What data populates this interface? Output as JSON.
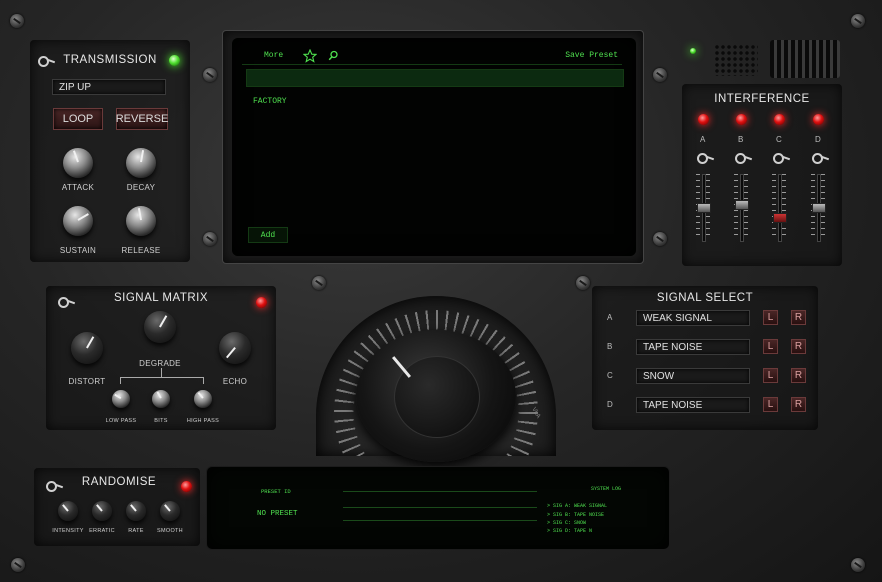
{
  "transmission": {
    "title": "TRANSMISSION",
    "preset_name": "ZIP UP",
    "loop_label": "LOOP",
    "reverse_label": "REVERSE",
    "knobs": [
      "ATTACK",
      "DECAY",
      "SUSTAIN",
      "RELEASE"
    ]
  },
  "browser": {
    "more_label": "More",
    "save_label": "Save Preset",
    "category": "FACTORY",
    "add_label": "Add"
  },
  "interference": {
    "title": "INTERFERENCE",
    "channels": [
      "A",
      "B",
      "C",
      "D"
    ],
    "fader_levels": [
      0.5,
      0.55,
      0.32,
      0.5
    ]
  },
  "signal_matrix": {
    "title": "SIGNAL MATRIX",
    "knobs": [
      "DISTORT",
      "DEGRADE",
      "ECHO"
    ],
    "sub_knobs": [
      "LOW PASS",
      "BITS",
      "HIGH PASS"
    ]
  },
  "signal_select": {
    "title": "SIGNAL SELECT",
    "rows": [
      {
        "letter": "A",
        "name": "WEAK SIGNAL",
        "l": "L",
        "r": "R"
      },
      {
        "letter": "B",
        "name": "TAPE NOISE",
        "l": "L",
        "r": "R"
      },
      {
        "letter": "C",
        "name": "SNOW",
        "l": "L",
        "r": "R"
      },
      {
        "letter": "D",
        "name": "TAPE NOISE",
        "l": "L",
        "r": "R"
      }
    ]
  },
  "main_dial": {
    "scale_label": "VLA"
  },
  "randomise": {
    "title": "RANDOMISE",
    "knobs": [
      "INTENSITY",
      "ERRATIC",
      "RATE",
      "SMOOTH"
    ]
  },
  "status_display": {
    "preset_id_label": "PRESET ID",
    "preset_id_value": "NO PRESET",
    "system_log_label": "SYSTEM LOG",
    "log_lines": [
      "> SIG A: WEAK SIGNAL",
      "> SIG B: TAPE NOISE",
      "> SIG C: SNOW",
      "> SIG D: TAPE N"
    ]
  },
  "colors": {
    "led_red": "#e01010",
    "led_green": "#50e030",
    "screen_text": "#4fe04f"
  }
}
